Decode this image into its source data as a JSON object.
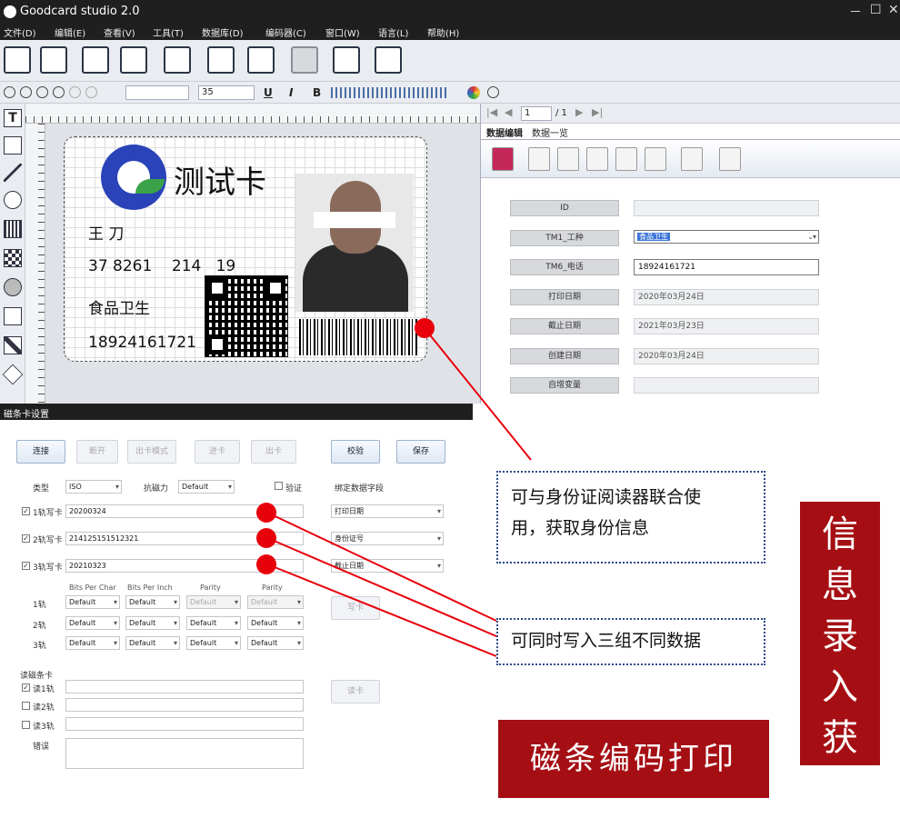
{
  "window": {
    "title": "Goodcard studio 2.0",
    "controls": [
      "－",
      "☐",
      "✕"
    ]
  },
  "menu": [
    "文件(D)",
    "编辑(E)",
    "查看(V)",
    "工具(T)",
    "数据库(D)",
    "编码器(C)",
    "窗口(W)",
    "语言(L)",
    "帮助(H)"
  ],
  "toolbar2": {
    "font_size": "35",
    "bold": "B",
    "italic": "I",
    "underline": "U"
  },
  "card": {
    "title": "测试卡",
    "name": "王 刀",
    "id_number": "37 8261    214   19",
    "job": "食品卫生",
    "phone": "18924161721"
  },
  "data_pane": {
    "page_current": "1",
    "page_total": "/ 1",
    "tabs": [
      "数据编辑",
      "数据一览"
    ],
    "fields": [
      {
        "label": "ID",
        "value": ""
      },
      {
        "label": "TM1_工种",
        "value": "食品卫生"
      },
      {
        "label": "TM6_电话",
        "value": "18924161721"
      },
      {
        "label": "打印日期",
        "value": "2020年03月24日"
      },
      {
        "label": "截止日期",
        "value": "2021年03月23日"
      },
      {
        "label": "创建日期",
        "value": "2020年03月24日"
      },
      {
        "label": "自增变量",
        "value": ""
      }
    ]
  },
  "dialog": {
    "title": "磁条卡设置",
    "buttons": {
      "connect": "连接",
      "disconnect": "断开",
      "eject_mode": "出卡模式",
      "feed": "进卡",
      "eject": "出卡",
      "verify": "校验",
      "save": "保存",
      "write": "写卡",
      "read": "读卡"
    },
    "type_label": "类型",
    "type_value": "ISO",
    "coercivity_label": "抗磁力",
    "coercivity_value": "Default",
    "verify_check": "验证",
    "bind_label": "绑定数据字段",
    "tracks": [
      {
        "label": "1轨写卡",
        "value": "20200324",
        "field": "打印日期"
      },
      {
        "label": "2轨写卡",
        "value": "214125151512321",
        "field": "身份证号"
      },
      {
        "label": "3轨写卡",
        "value": "20210323",
        "field": "截止日期"
      }
    ],
    "param_headers": [
      "Bits Per Char",
      "Bits Per Inch",
      "Parity",
      "Parity"
    ],
    "param_rows": [
      "1轨",
      "2轨",
      "3轨"
    ],
    "default": "Default",
    "read_group": "读磁条卡",
    "read_tracks": [
      "读1轨",
      "读2轨",
      "读3轨"
    ],
    "error_label": "错误"
  },
  "annotations": {
    "note1_line1": "可与身份证阅读器联合使",
    "note1_line2": "用，获取身份信息",
    "note2": "可同时写入三组不同数据",
    "banner_right": "信息录入获取",
    "banner_bottom": "磁条编码打印"
  },
  "colors": {
    "dark_bar": "#1f1f1f",
    "banner_red": "#a50f14",
    "dot_red": "#e8000b",
    "logo_blue": "#2a43b8",
    "note_border": "#2b4a8a"
  }
}
